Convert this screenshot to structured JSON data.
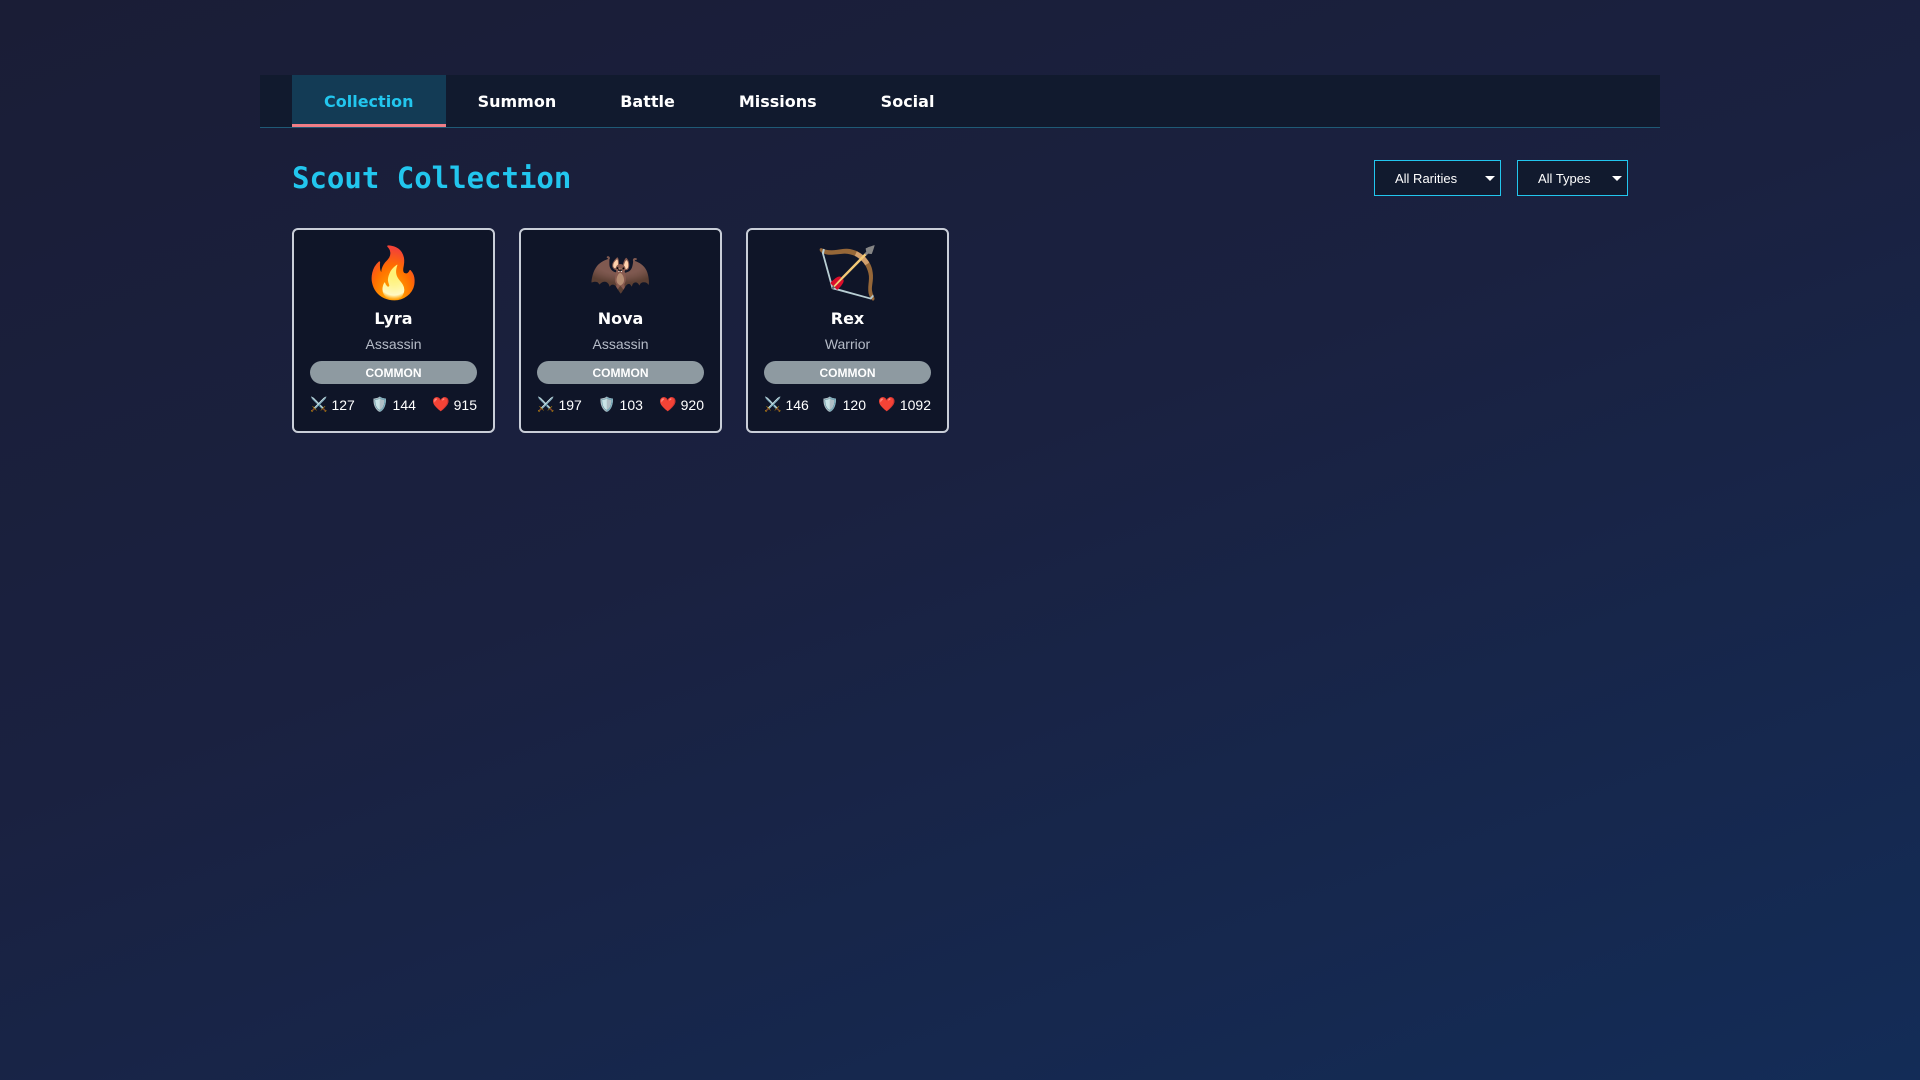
{
  "tabs": [
    {
      "label": "Collection",
      "active": true
    },
    {
      "label": "Summon",
      "active": false
    },
    {
      "label": "Battle",
      "active": false
    },
    {
      "label": "Missions",
      "active": false
    },
    {
      "label": "Social",
      "active": false
    }
  ],
  "page_title": "Scout Collection",
  "filters": {
    "rarity": {
      "selected": "All Rarities"
    },
    "type": {
      "selected": "All Types"
    }
  },
  "icons": {
    "attack": "⚔️",
    "defense": "🛡️",
    "health": "❤️"
  },
  "colors": {
    "accent": "#22c6ee",
    "tab_underline": "#ef7d86",
    "common_badge": "#8e9aa1"
  },
  "cards": [
    {
      "icon": "🔥",
      "icon_name": "fire-icon",
      "name": "Lyra",
      "class": "Assassin",
      "rarity": "COMMON",
      "attack": "127",
      "defense": "144",
      "health": "915"
    },
    {
      "icon": "🦇",
      "icon_name": "bat-icon",
      "name": "Nova",
      "class": "Assassin",
      "rarity": "COMMON",
      "attack": "197",
      "defense": "103",
      "health": "920"
    },
    {
      "icon": "🏹",
      "icon_name": "bow-and-arrow-icon",
      "name": "Rex",
      "class": "Warrior",
      "rarity": "COMMON",
      "attack": "146",
      "defense": "120",
      "health": "1092"
    }
  ]
}
